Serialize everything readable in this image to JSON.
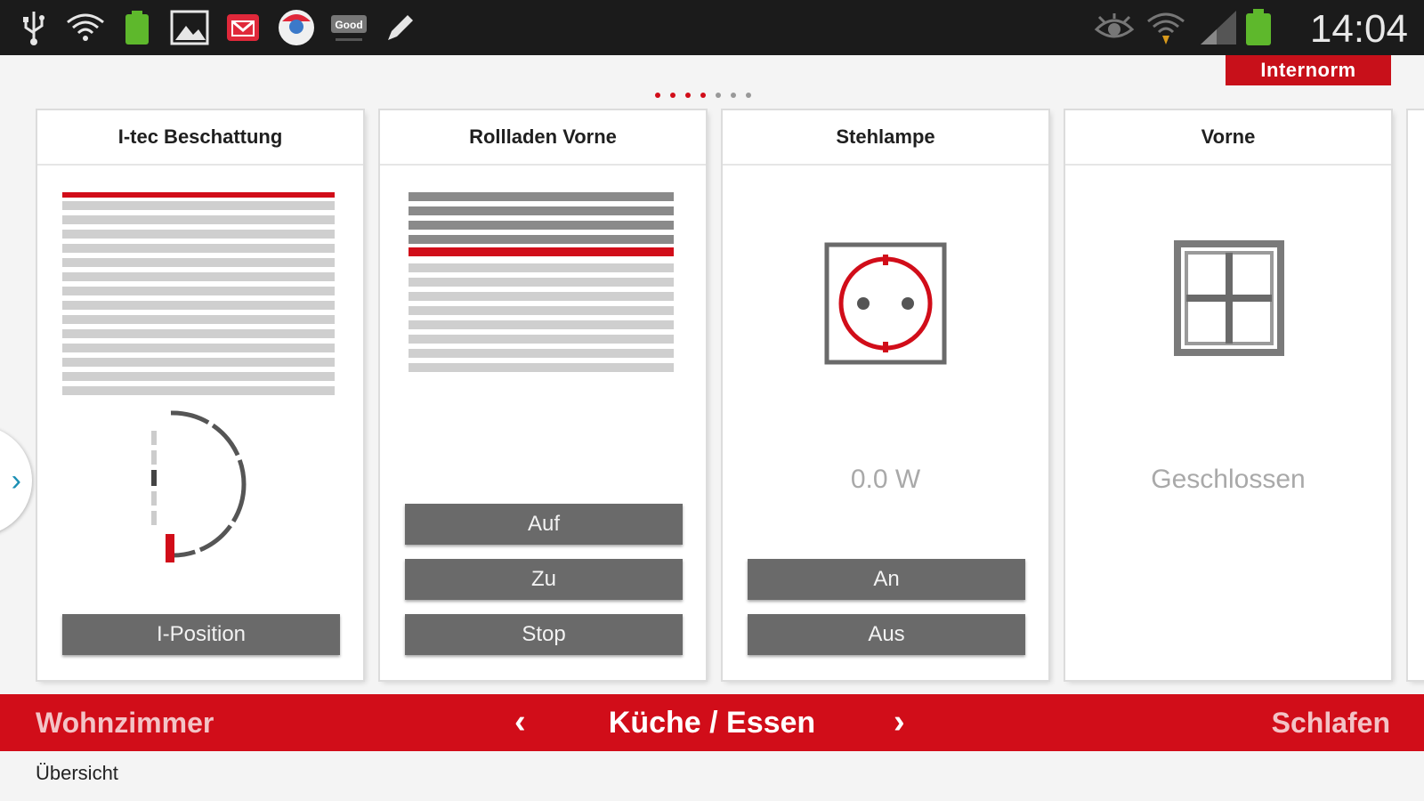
{
  "status_bar": {
    "time": "14:04",
    "icons": [
      "usb-icon",
      "wifi-signal-icon",
      "battery-app-icon",
      "gallery-icon",
      "mail-icon",
      "app-icon",
      "good-app-icon",
      "edit-icon",
      "eye-icon",
      "wifi-icon",
      "cell-signal-icon",
      "battery-icon"
    ],
    "good_label": "Good"
  },
  "brand": {
    "label": "Internorm"
  },
  "page_dots": {
    "total": 7,
    "active": 4,
    "active_color": "#d10d19",
    "inactive_color": "#999999"
  },
  "cards": [
    {
      "title": "I-tec Beschattung",
      "button": "I-Position"
    },
    {
      "title": "Rollladen Vorne",
      "buttons": [
        "Auf",
        "Zu",
        "Stop"
      ]
    },
    {
      "title": "Stehlampe",
      "value": "0.0 W",
      "buttons": [
        "An",
        "Aus"
      ]
    },
    {
      "title": "Vorne",
      "value": "Geschlossen"
    }
  ],
  "room_nav": {
    "previous": "Wohnzimmer",
    "current": "Küche / Essen",
    "next": "Schlafen",
    "prev_arrow": "‹",
    "next_arrow": "›"
  },
  "overview_label": "Übersicht",
  "colors": {
    "accent": "#d10d19",
    "button": "#6a6a6a",
    "status_bar": "#1b1b1b"
  }
}
